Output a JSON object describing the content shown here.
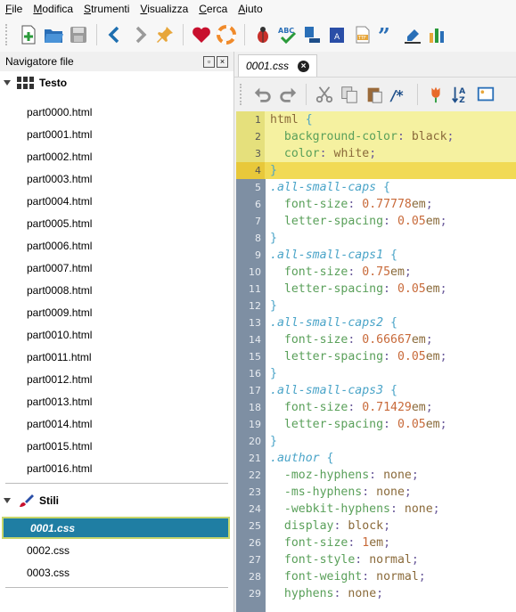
{
  "menubar": {
    "items": [
      {
        "label": "File",
        "underline": "F"
      },
      {
        "label": "Modifica",
        "underline": "M"
      },
      {
        "label": "Strumenti",
        "underline": "S"
      },
      {
        "label": "Visualizza",
        "underline": "V"
      },
      {
        "label": "Cerca",
        "underline": "C"
      },
      {
        "label": "Aiuto",
        "underline": "A"
      }
    ]
  },
  "toolbar": {
    "icons": [
      "new-file-icon",
      "open-folder-icon",
      "save-icon",
      "back-icon",
      "forward-icon",
      "pin-icon",
      "heart-icon",
      "lifebuoy-icon",
      "bug-icon",
      "spellcheck-icon",
      "text-flow-icon",
      "book-icon",
      "font-file-icon",
      "quote-icon",
      "eraser-icon",
      "bar-chart-icon"
    ]
  },
  "navigator": {
    "title": "Navigatore file",
    "text_folder": "Testo",
    "text_files": [
      "part0000.html",
      "part0001.html",
      "part0002.html",
      "part0003.html",
      "part0004.html",
      "part0005.html",
      "part0006.html",
      "part0007.html",
      "part0008.html",
      "part0009.html",
      "part0010.html",
      "part0011.html",
      "part0012.html",
      "part0013.html",
      "part0014.html",
      "part0015.html",
      "part0016.html"
    ],
    "styles_folder": "Stili",
    "style_files": [
      "0001.css",
      "0002.css",
      "0003.css"
    ],
    "selected": "0001.css"
  },
  "editor": {
    "tab_label": "0001.css",
    "lines": [
      {
        "n": "1",
        "t": "html {"
      },
      {
        "n": "2",
        "t": "  background-color: black;"
      },
      {
        "n": "3",
        "t": "  color: white;"
      },
      {
        "n": "4",
        "t": "}"
      },
      {
        "n": "5",
        "t": ".all-small-caps {"
      },
      {
        "n": "6",
        "t": "  font-size: 0.77778em;"
      },
      {
        "n": "7",
        "t": "  letter-spacing: 0.05em;"
      },
      {
        "n": "8",
        "t": "}"
      },
      {
        "n": "9",
        "t": ".all-small-caps1 {"
      },
      {
        "n": "10",
        "t": "  font-size: 0.75em;"
      },
      {
        "n": "11",
        "t": "  letter-spacing: 0.05em;"
      },
      {
        "n": "12",
        "t": "}"
      },
      {
        "n": "13",
        "t": ".all-small-caps2 {"
      },
      {
        "n": "14",
        "t": "  font-size: 0.66667em;"
      },
      {
        "n": "15",
        "t": "  letter-spacing: 0.05em;"
      },
      {
        "n": "16",
        "t": "}"
      },
      {
        "n": "17",
        "t": ".all-small-caps3 {"
      },
      {
        "n": "18",
        "t": "  font-size: 0.71429em;"
      },
      {
        "n": "19",
        "t": "  letter-spacing: 0.05em;"
      },
      {
        "n": "20",
        "t": "}"
      },
      {
        "n": "21",
        "t": ".author {"
      },
      {
        "n": "22",
        "t": "  -moz-hyphens: none;"
      },
      {
        "n": "23",
        "t": "  -ms-hyphens: none;"
      },
      {
        "n": "24",
        "t": "  -webkit-hyphens: none;"
      },
      {
        "n": "25",
        "t": "  display: block;"
      },
      {
        "n": "26",
        "t": "  font-size: 1em;"
      },
      {
        "n": "27",
        "t": "  font-style: normal;"
      },
      {
        "n": "28",
        "t": "  font-weight: normal;"
      },
      {
        "n": "29",
        "t": "  hyphens: none;"
      }
    ]
  },
  "colors": {
    "selected_bg": "#1f7ea3",
    "gutter": "#7e8fa3",
    "highlight": "#f5f1a0",
    "current_line": "#f1da55"
  }
}
